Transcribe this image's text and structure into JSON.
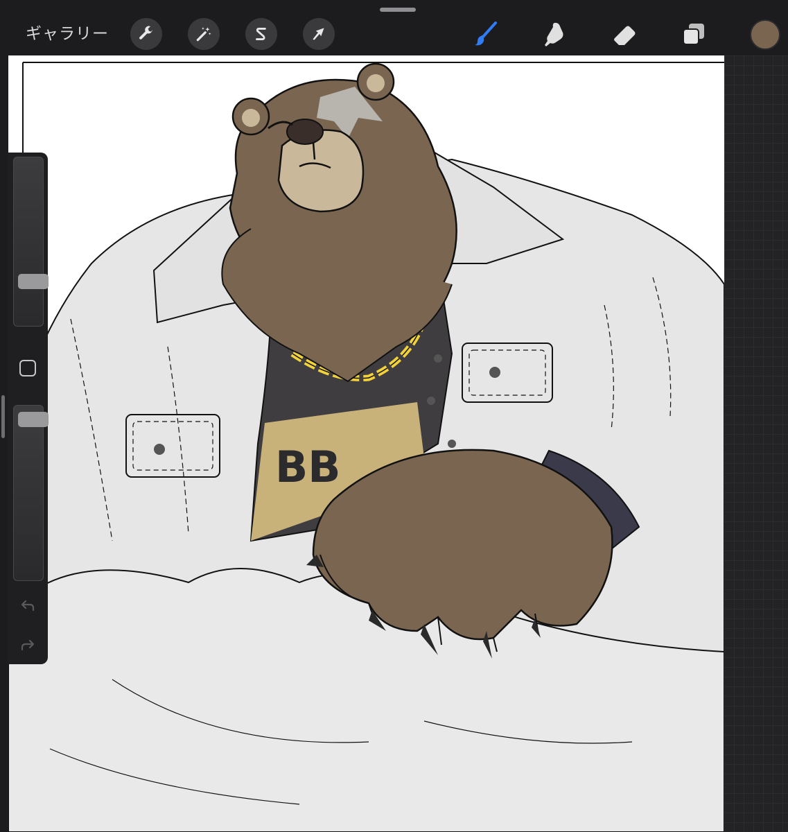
{
  "toolbar": {
    "gallery_label": "ギャラリー",
    "left_tools": [
      {
        "name": "actions",
        "icon": "wrench-icon"
      },
      {
        "name": "adjustments",
        "icon": "magic-wand-icon"
      },
      {
        "name": "selection",
        "icon": "selection-s-icon"
      },
      {
        "name": "transform",
        "icon": "arrow-cursor-icon"
      }
    ],
    "right_tools": [
      {
        "name": "brush",
        "icon": "brush-icon",
        "active": true
      },
      {
        "name": "smudge",
        "icon": "smudge-finger-icon",
        "active": false
      },
      {
        "name": "eraser",
        "icon": "eraser-icon",
        "active": false
      },
      {
        "name": "layers",
        "icon": "layers-icon",
        "active": false
      }
    ],
    "current_color": "#7a6650",
    "active_color": "#2f7df6"
  },
  "sidebar": {
    "brush_size_level": 0.24,
    "opacity_level": 0.96,
    "modify_icon": "square-modify-icon",
    "undo_icon": "undo-arrow-icon",
    "redo_icon": "redo-arrow-icon"
  },
  "canvas": {
    "artwork": "bear-character-illustration",
    "palette": {
      "fur": "#7a6650",
      "muzzle": "#c9b99a",
      "scar": "#b8b4ae",
      "jacket": "#e6e6e6",
      "shirt": "#3f3d40",
      "shirt_print": "#c8b27a",
      "chain": "#f2d23a",
      "outline": "#111111"
    },
    "shirt_print_text": "BB"
  }
}
